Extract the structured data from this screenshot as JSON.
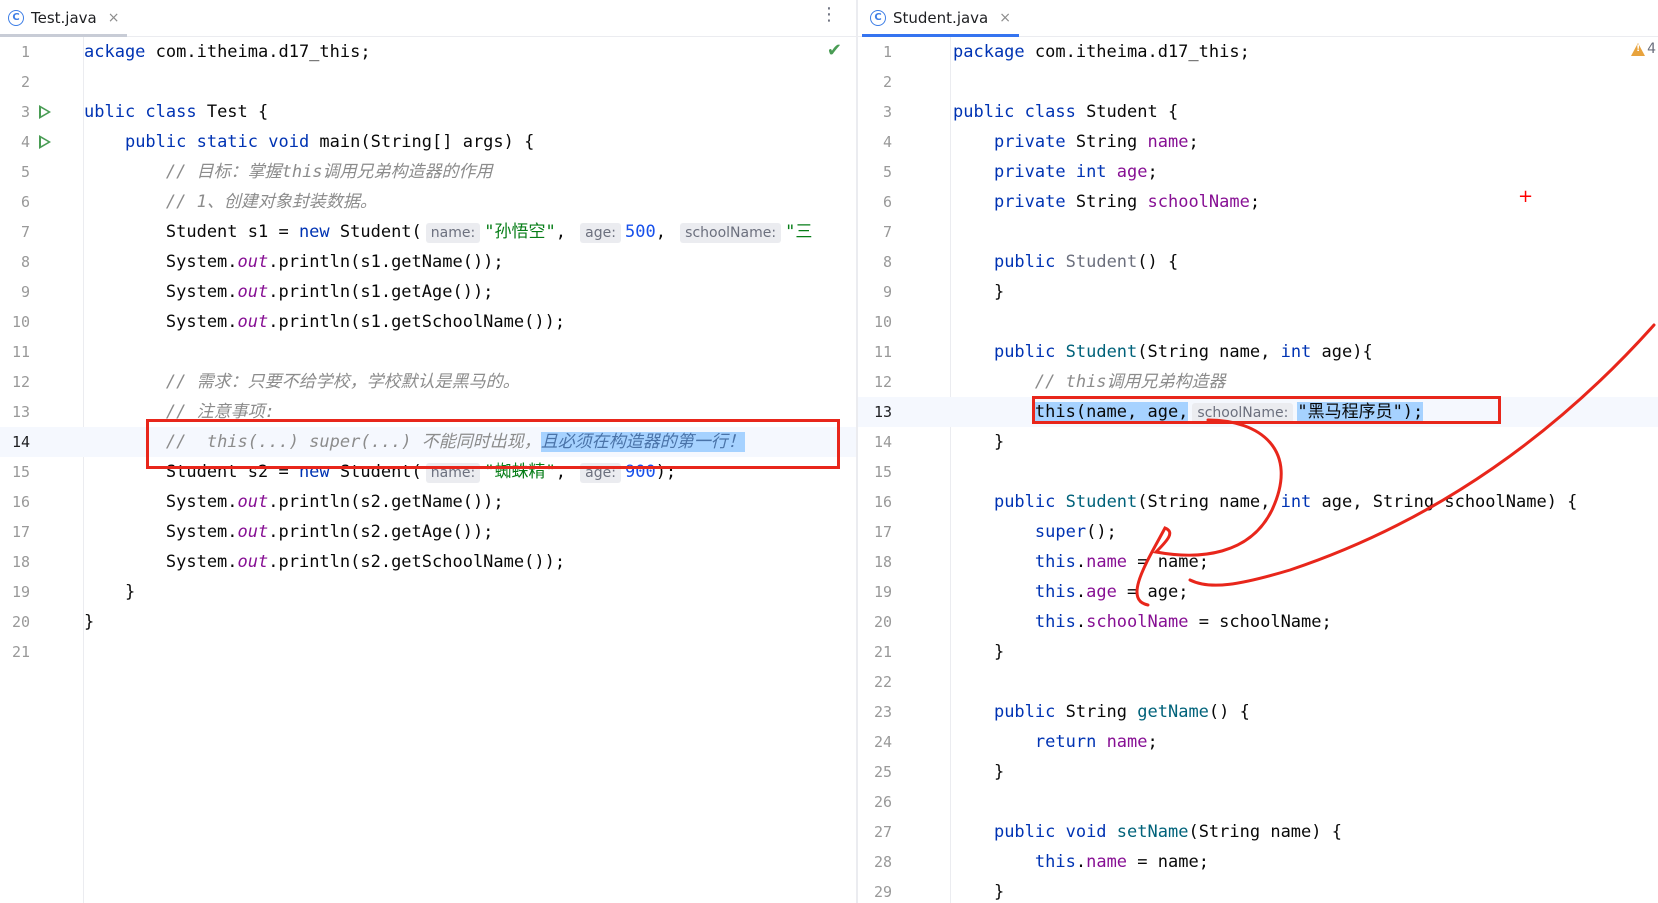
{
  "left_editor": {
    "tab": {
      "icon": "class-icon",
      "label": "Test.java"
    },
    "status_icon": "check-icon",
    "lines": [
      {
        "num": "1",
        "parts": [
          [
            "ackage",
            "kw"
          ],
          [
            " com.itheima.d17_this;",
            ""
          ]
        ]
      },
      {
        "num": "2",
        "parts": []
      },
      {
        "num": "3",
        "run": true,
        "parts": [
          [
            "ublic class",
            "kw"
          ],
          [
            " Test {",
            ""
          ]
        ]
      },
      {
        "num": "4",
        "run": true,
        "parts": [
          [
            "    ",
            ""
          ],
          [
            "public static void",
            "kw"
          ],
          [
            " main(String[] args) {",
            ""
          ]
        ]
      },
      {
        "num": "5",
        "parts": [
          [
            "        ",
            ""
          ],
          [
            "// 目标：掌握this调用兄弟构造器的作用",
            "cm"
          ]
        ]
      },
      {
        "num": "6",
        "parts": [
          [
            "        ",
            ""
          ],
          [
            "// 1、创建对象封装数据。",
            "cm"
          ]
        ]
      },
      {
        "num": "7",
        "parts": [
          [
            "        Student s1 = ",
            ""
          ],
          [
            "new",
            "kw"
          ],
          [
            " Student(",
            ""
          ],
          [
            "name:",
            "hint"
          ],
          [
            "\"孙悟空\"",
            "str"
          ],
          [
            ", ",
            ""
          ],
          [
            "age:",
            "hint"
          ],
          [
            "500",
            "num"
          ],
          [
            ", ",
            ""
          ],
          [
            "schoolName:",
            "hint"
          ],
          [
            "\"三",
            "str"
          ]
        ]
      },
      {
        "num": "8",
        "parts": [
          [
            "        System.",
            ""
          ],
          [
            "out",
            "fldi"
          ],
          [
            ".println(s1.getName());",
            ""
          ]
        ]
      },
      {
        "num": "9",
        "parts": [
          [
            "        System.",
            ""
          ],
          [
            "out",
            "fldi"
          ],
          [
            ".println(s1.getAge());",
            ""
          ]
        ]
      },
      {
        "num": "10",
        "parts": [
          [
            "        System.",
            ""
          ],
          [
            "out",
            "fldi"
          ],
          [
            ".println(s1.getSchoolName());",
            ""
          ]
        ]
      },
      {
        "num": "11",
        "parts": []
      },
      {
        "num": "12",
        "parts": [
          [
            "        ",
            ""
          ],
          [
            "// 需求：只要不给学校，学校默认是黑马的。",
            "cm"
          ]
        ]
      },
      {
        "num": "13",
        "parts": [
          [
            "        ",
            ""
          ],
          [
            "// 注意事项:",
            "cm"
          ]
        ]
      },
      {
        "num": "14",
        "current": true,
        "parts": [
          [
            "        ",
            ""
          ],
          [
            "//  this(...) super(...) 不能同时出现，",
            "cm"
          ],
          [
            "且必须在构造器的第一行！",
            "selc"
          ]
        ]
      },
      {
        "num": "15",
        "parts": [
          [
            "        Student s2 = ",
            ""
          ],
          [
            "new",
            "kw"
          ],
          [
            " Student(",
            ""
          ],
          [
            "name:",
            "hint"
          ],
          [
            "\"蜘蛛精\"",
            "str"
          ],
          [
            ", ",
            ""
          ],
          [
            "age:",
            "hint"
          ],
          [
            "900",
            "num"
          ],
          [
            ");",
            ""
          ]
        ]
      },
      {
        "num": "16",
        "parts": [
          [
            "        System.",
            ""
          ],
          [
            "out",
            "fldi"
          ],
          [
            ".println(s2.getName());",
            ""
          ]
        ]
      },
      {
        "num": "17",
        "parts": [
          [
            "        System.",
            ""
          ],
          [
            "out",
            "fldi"
          ],
          [
            ".println(s2.getAge());",
            ""
          ]
        ]
      },
      {
        "num": "18",
        "parts": [
          [
            "        System.",
            ""
          ],
          [
            "out",
            "fldi"
          ],
          [
            ".println(s2.getSchoolName());",
            ""
          ]
        ]
      },
      {
        "num": "19",
        "parts": [
          [
            "    }",
            ""
          ]
        ]
      },
      {
        "num": "20",
        "parts": [
          [
            "}",
            ""
          ]
        ]
      },
      {
        "num": "21",
        "parts": []
      }
    ]
  },
  "right_editor": {
    "tab": {
      "icon": "class-icon",
      "label": "Student.java"
    },
    "warnings": "4",
    "lines": [
      {
        "num": "1",
        "parts": [
          [
            "package",
            "kw"
          ],
          [
            " com.itheima.d17_this;",
            ""
          ]
        ]
      },
      {
        "num": "2",
        "parts": []
      },
      {
        "num": "3",
        "parts": [
          [
            "public class",
            "kw"
          ],
          [
            " Student {",
            ""
          ]
        ]
      },
      {
        "num": "4",
        "parts": [
          [
            "    ",
            ""
          ],
          [
            "private",
            "kw"
          ],
          [
            " String ",
            ""
          ],
          [
            "name",
            "fld"
          ],
          [
            ";",
            ""
          ]
        ]
      },
      {
        "num": "5",
        "parts": [
          [
            "    ",
            ""
          ],
          [
            "private int",
            "kw"
          ],
          [
            " ",
            ""
          ],
          [
            "age",
            "fld"
          ],
          [
            ";",
            ""
          ]
        ]
      },
      {
        "num": "6",
        "parts": [
          [
            "    ",
            ""
          ],
          [
            "private",
            "kw"
          ],
          [
            " String ",
            ""
          ],
          [
            "schoolName",
            "fld"
          ],
          [
            ";",
            ""
          ]
        ]
      },
      {
        "num": "7",
        "parts": []
      },
      {
        "num": "8",
        "parts": [
          [
            "    ",
            ""
          ],
          [
            "public",
            "kw"
          ],
          [
            " ",
            ""
          ],
          [
            "Student",
            "dim"
          ],
          [
            "() {",
            ""
          ]
        ]
      },
      {
        "num": "9",
        "parts": [
          [
            "    }",
            ""
          ]
        ]
      },
      {
        "num": "10",
        "parts": []
      },
      {
        "num": "11",
        "parts": [
          [
            "    ",
            ""
          ],
          [
            "public",
            "kw"
          ],
          [
            " ",
            ""
          ],
          [
            "Student",
            "fn"
          ],
          [
            "(String name, ",
            ""
          ],
          [
            "int",
            "kw"
          ],
          [
            " age){",
            ""
          ]
        ]
      },
      {
        "num": "12",
        "parts": [
          [
            "        ",
            ""
          ],
          [
            "// this调用兄弟构造器",
            "cm"
          ]
        ]
      },
      {
        "num": "13",
        "current": true,
        "parts": [
          [
            "        ",
            ""
          ],
          [
            "this(name, age,",
            "sel"
          ],
          [
            "schoolName:",
            "hint"
          ],
          [
            "\"黑马程序员\");",
            "sel"
          ]
        ]
      },
      {
        "num": "14",
        "parts": [
          [
            "    }",
            ""
          ]
        ]
      },
      {
        "num": "15",
        "parts": []
      },
      {
        "num": "16",
        "parts": [
          [
            "    ",
            ""
          ],
          [
            "public",
            "kw"
          ],
          [
            " ",
            ""
          ],
          [
            "Student",
            "fn"
          ],
          [
            "(String name, ",
            ""
          ],
          [
            "int",
            "kw"
          ],
          [
            " age, String schoolName) {",
            ""
          ]
        ]
      },
      {
        "num": "17",
        "parts": [
          [
            "        ",
            ""
          ],
          [
            "super",
            "kw"
          ],
          [
            "();",
            ""
          ]
        ]
      },
      {
        "num": "18",
        "parts": [
          [
            "        ",
            ""
          ],
          [
            "this",
            "kw"
          ],
          [
            ".",
            ""
          ],
          [
            "name",
            "fld"
          ],
          [
            " = name;",
            ""
          ]
        ]
      },
      {
        "num": "19",
        "parts": [
          [
            "        ",
            ""
          ],
          [
            "this",
            "kw"
          ],
          [
            ".",
            ""
          ],
          [
            "age",
            "fld"
          ],
          [
            " = age;",
            ""
          ]
        ]
      },
      {
        "num": "20",
        "parts": [
          [
            "        ",
            ""
          ],
          [
            "this",
            "kw"
          ],
          [
            ".",
            ""
          ],
          [
            "schoolName",
            "fld"
          ],
          [
            " = schoolName;",
            ""
          ]
        ]
      },
      {
        "num": "21",
        "parts": [
          [
            "    }",
            ""
          ]
        ]
      },
      {
        "num": "22",
        "parts": []
      },
      {
        "num": "23",
        "parts": [
          [
            "    ",
            ""
          ],
          [
            "public",
            "kw"
          ],
          [
            " String ",
            ""
          ],
          [
            "getName",
            "fn"
          ],
          [
            "() {",
            ""
          ]
        ]
      },
      {
        "num": "24",
        "parts": [
          [
            "        ",
            ""
          ],
          [
            "return",
            "kw"
          ],
          [
            " ",
            ""
          ],
          [
            "name",
            "fld"
          ],
          [
            ";",
            ""
          ]
        ]
      },
      {
        "num": "25",
        "parts": [
          [
            "    }",
            ""
          ]
        ]
      },
      {
        "num": "26",
        "parts": []
      },
      {
        "num": "27",
        "parts": [
          [
            "    ",
            ""
          ],
          [
            "public void",
            "kw"
          ],
          [
            " ",
            ""
          ],
          [
            "setName",
            "fn"
          ],
          [
            "(String name) {",
            ""
          ]
        ]
      },
      {
        "num": "28",
        "parts": [
          [
            "        ",
            ""
          ],
          [
            "this",
            "kw"
          ],
          [
            ".",
            ""
          ],
          [
            "name",
            "fld"
          ],
          [
            " = name;",
            ""
          ]
        ]
      },
      {
        "num": "29",
        "parts": [
          [
            "    }",
            ""
          ]
        ]
      }
    ]
  },
  "annotation_color": "#e8261b"
}
